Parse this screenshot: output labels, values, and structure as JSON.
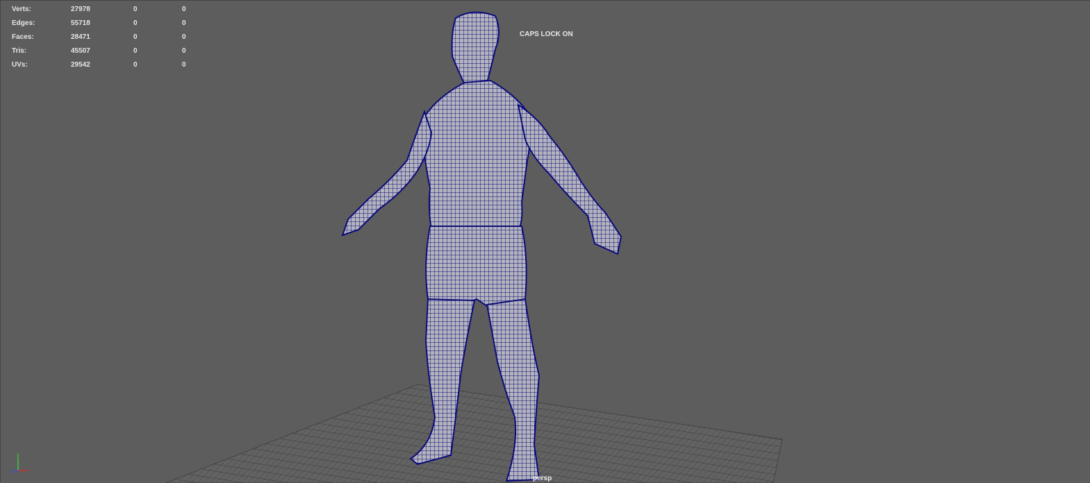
{
  "hud": {
    "rows": [
      {
        "label": "Verts:",
        "total": "27978",
        "selected": "0",
        "component": "0"
      },
      {
        "label": "Edges:",
        "total": "55718",
        "selected": "0",
        "component": "0"
      },
      {
        "label": "Faces:",
        "total": "28471",
        "selected": "0",
        "component": "0"
      },
      {
        "label": "Tris:",
        "total": "45507",
        "selected": "0",
        "component": "0"
      },
      {
        "label": "UVs:",
        "total": "29542",
        "selected": "0",
        "component": "0"
      }
    ]
  },
  "status": {
    "caps_lock": "CAPS LOCK ON"
  },
  "camera": {
    "name": "persp"
  },
  "axis": {
    "x": "x",
    "y": "y",
    "z": "z"
  },
  "colors": {
    "background": "#5d5d5d",
    "wireframe": "#0b0b7a",
    "mesh": "#b8b8c0",
    "grid": "#3f3f3f"
  }
}
